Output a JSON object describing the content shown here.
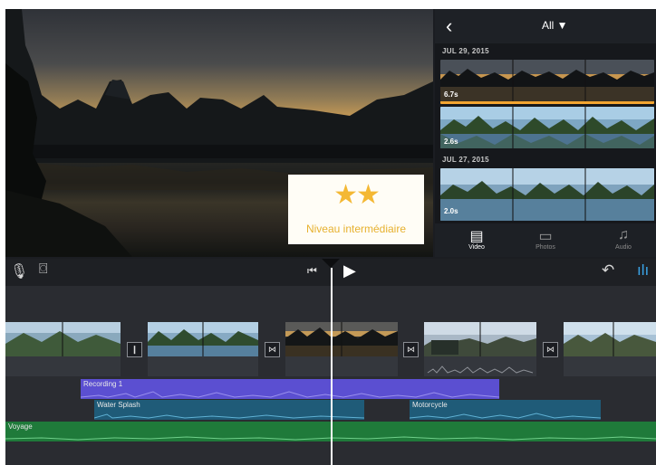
{
  "browser": {
    "filter_label": "All ▼",
    "sections": [
      {
        "date": "JUL 29, 2015",
        "clips": [
          {
            "duration": "6.7s"
          },
          {
            "duration": "2.6s"
          }
        ]
      },
      {
        "date": "JUL 27, 2015",
        "clips": [
          {
            "duration": "2.0s"
          }
        ]
      }
    ],
    "tabs": [
      {
        "label": "Video",
        "icon": "film-icon",
        "active": true
      },
      {
        "label": "Photos",
        "icon": "photos-icon",
        "active": false
      },
      {
        "label": "Audio",
        "icon": "music-note-icon",
        "active": false
      }
    ]
  },
  "overlay": {
    "stars": "★★",
    "text": "Niveau intermédiaire"
  },
  "timeline": {
    "audio_tracks": [
      {
        "label": "Recording 1",
        "color": "#5b4fd1"
      },
      {
        "label": "Water Splash",
        "color": "#1f5b78"
      },
      {
        "label": "Motorcycle",
        "color": "#1f5b78"
      },
      {
        "label": "Voyage",
        "color": "#1f7a3a"
      }
    ]
  },
  "colors": {
    "accent": "#f4b834",
    "selection": "#f2a531",
    "audio_icon": "#3aa3e6"
  }
}
